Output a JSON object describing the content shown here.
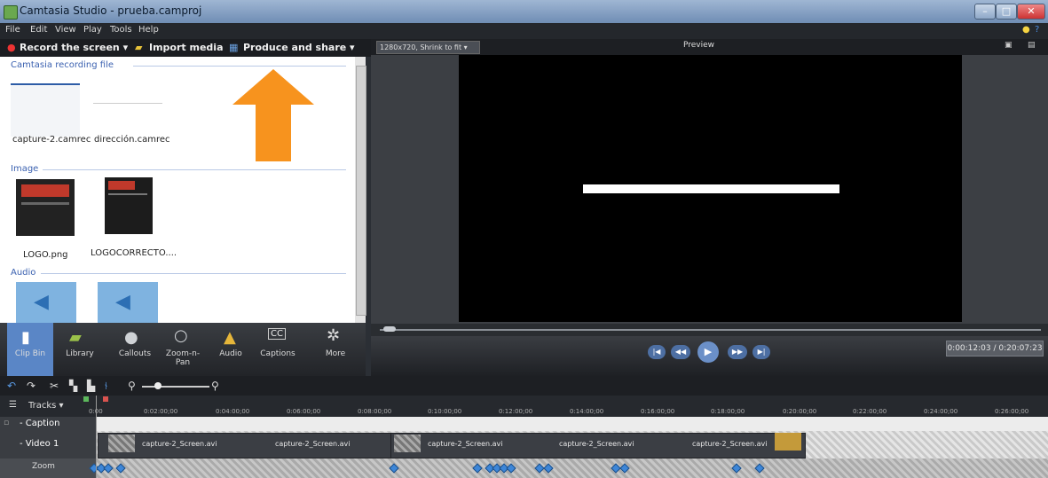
{
  "window": {
    "title": "Camtasia Studio - prueba.camproj"
  },
  "menu": [
    "File",
    "Edit",
    "View",
    "Play",
    "Tools",
    "Help"
  ],
  "toolbar": {
    "record": "Record the screen ▾",
    "import": "Import media",
    "produce": "Produce and share ▾"
  },
  "bin": {
    "recording_title": "Camtasia recording file",
    "recordings": [
      "capture-2.camrec",
      "dirección.camrec"
    ],
    "image_title": "Image",
    "images": [
      "LOGO.png",
      "LOGOCORRECTO...."
    ],
    "audio_title": "Audio"
  },
  "tabs": [
    "Clip Bin",
    "Library",
    "Callouts",
    "Zoom-n-\nPan",
    "Audio",
    "Captions",
    "More"
  ],
  "tab_icons": [
    "clip-bin-icon",
    "library-icon",
    "callouts-icon",
    "zoom-n-pan-icon",
    "audio-icon",
    "captions-icon",
    "more-icon"
  ],
  "preview": {
    "resolution": "1280x720, Shrink to fit ▾",
    "label": "Preview",
    "time": "0:00:12:03 / 0:20:07:23"
  },
  "timeline": {
    "tracks_label": "Tracks ▾",
    "ticks": [
      "0:00",
      "0:02:00;00",
      "0:04:00;00",
      "0:06:00;00",
      "0:08:00;00",
      "0:10:00;00",
      "0:12:00;00",
      "0:14:00;00",
      "0:16:00;00",
      "0:18:00;00",
      "0:20:00;00",
      "0:22:00;00",
      "0:24:00;00",
      "0:26:00;00"
    ],
    "caption_row": "- Caption",
    "video_row": "- Video 1",
    "zoom_row": "Zoom",
    "clips": [
      "capture-2_Screen.avi",
      "capture-2_Screen.avi",
      "capture-2_Screen.avi",
      "capture-2_Screen.avi",
      "capture-2_Screen.avi"
    ]
  },
  "colors": {
    "arrow": "#f7931e",
    "accent": "#3b61b0",
    "zoom_marker": "#3d86d8"
  }
}
